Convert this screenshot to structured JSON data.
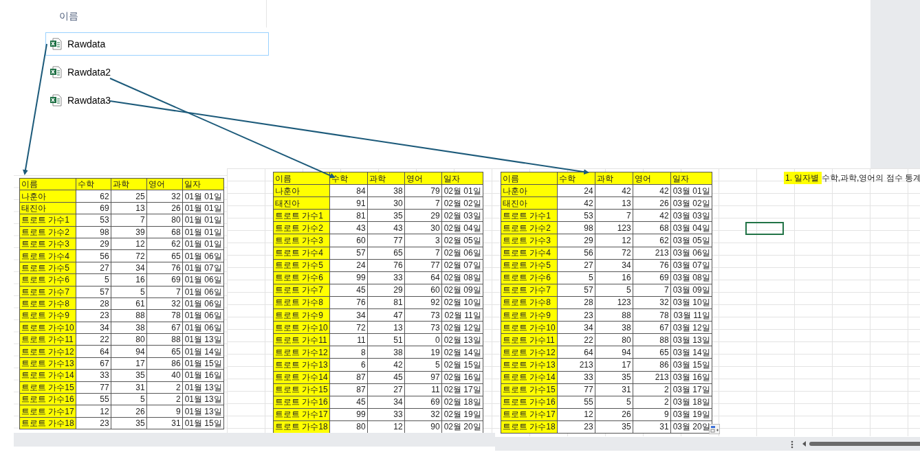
{
  "explorer": {
    "column_header": "이름",
    "files": [
      {
        "name": "Rawdata",
        "selected": true
      },
      {
        "name": "Rawdata2",
        "selected": false
      },
      {
        "name": "Rawdata3",
        "selected": false
      }
    ]
  },
  "tables": [
    {
      "columns": [
        "이름",
        "수학",
        "과학",
        "영어",
        "일자"
      ],
      "rows": [
        [
          "나훈아",
          "62",
          "25",
          "32",
          "01월 01일"
        ],
        [
          "태진아",
          "69",
          "13",
          "26",
          "01월 01일"
        ],
        [
          "트로트 가수1",
          "53",
          "7",
          "80",
          "01월 01일"
        ],
        [
          "트로트 가수2",
          "98",
          "39",
          "68",
          "01월 01일"
        ],
        [
          "트로트 가수3",
          "29",
          "12",
          "62",
          "01월 01일"
        ],
        [
          "트로트 가수4",
          "56",
          "72",
          "65",
          "01월 06일"
        ],
        [
          "트로트 가수5",
          "27",
          "34",
          "76",
          "01월 07일"
        ],
        [
          "트로트 가수6",
          "5",
          "16",
          "69",
          "01월 06일"
        ],
        [
          "트로트 가수7",
          "57",
          "5",
          "7",
          "01월 06일"
        ],
        [
          "트로트 가수8",
          "28",
          "61",
          "32",
          "01월 06일"
        ],
        [
          "트로트 가수9",
          "23",
          "88",
          "78",
          "01월 06일"
        ],
        [
          "트로트 가수10",
          "34",
          "38",
          "67",
          "01월 06일"
        ],
        [
          "트로트 가수11",
          "22",
          "80",
          "88",
          "01월 13일"
        ],
        [
          "트로트 가수12",
          "64",
          "94",
          "65",
          "01월 14일"
        ],
        [
          "트로트 가수13",
          "67",
          "17",
          "86",
          "01월 15일"
        ],
        [
          "트로트 가수14",
          "33",
          "35",
          "40",
          "01월 16일"
        ],
        [
          "트로트 가수15",
          "77",
          "31",
          "2",
          "01월 13일"
        ],
        [
          "트로트 가수16",
          "55",
          "5",
          "2",
          "01월 13일"
        ],
        [
          "트로트 가수17",
          "12",
          "26",
          "9",
          "01월 13일"
        ],
        [
          "트로트 가수18",
          "23",
          "35",
          "31",
          "01월 15일"
        ]
      ]
    },
    {
      "columns": [
        "이름",
        "수학",
        "과학",
        "영어",
        "일자"
      ],
      "rows": [
        [
          "나훈아",
          "84",
          "38",
          "79",
          "02월 01일"
        ],
        [
          "태진아",
          "91",
          "30",
          "7",
          "02월 02일"
        ],
        [
          "트로트 가수1",
          "81",
          "35",
          "29",
          "02월 03일"
        ],
        [
          "트로트 가수2",
          "43",
          "43",
          "30",
          "02월 04일"
        ],
        [
          "트로트 가수3",
          "60",
          "77",
          "3",
          "02월 05일"
        ],
        [
          "트로트 가수4",
          "57",
          "65",
          "7",
          "02월 06일"
        ],
        [
          "트로트 가수5",
          "24",
          "76",
          "77",
          "02월 07일"
        ],
        [
          "트로트 가수6",
          "99",
          "33",
          "64",
          "02월 08일"
        ],
        [
          "트로트 가수7",
          "45",
          "29",
          "60",
          "02월 09일"
        ],
        [
          "트로트 가수8",
          "76",
          "81",
          "92",
          "02월 10일"
        ],
        [
          "트로트 가수9",
          "34",
          "47",
          "73",
          "02월 11일"
        ],
        [
          "트로트 가수10",
          "72",
          "13",
          "73",
          "02월 12일"
        ],
        [
          "트로트 가수11",
          "11",
          "51",
          "0",
          "02월 13일"
        ],
        [
          "트로트 가수12",
          "8",
          "38",
          "19",
          "02월 14일"
        ],
        [
          "트로트 가수13",
          "6",
          "42",
          "5",
          "02월 15일"
        ],
        [
          "트로트 가수14",
          "87",
          "45",
          "97",
          "02월 16일"
        ],
        [
          "트로트 가수15",
          "87",
          "27",
          "11",
          "02월 17일"
        ],
        [
          "트로트 가수16",
          "45",
          "34",
          "69",
          "02월 18일"
        ],
        [
          "트로트 가수17",
          "99",
          "33",
          "32",
          "02월 19일"
        ],
        [
          "트로트 가수18",
          "80",
          "12",
          "90",
          "02월 20일"
        ]
      ]
    },
    {
      "columns": [
        "이름",
        "수학",
        "과학",
        "영어",
        "일자"
      ],
      "rows": [
        [
          "나훈아",
          "24",
          "42",
          "42",
          "03월 01일"
        ],
        [
          "태진아",
          "42",
          "13",
          "26",
          "03월 02일"
        ],
        [
          "트로트 가수1",
          "53",
          "7",
          "42",
          "03월 03일"
        ],
        [
          "트로트 가수2",
          "98",
          "123",
          "68",
          "03월 04일"
        ],
        [
          "트로트 가수3",
          "29",
          "12",
          "62",
          "03월 05일"
        ],
        [
          "트로트 가수4",
          "56",
          "72",
          "213",
          "03월 06일"
        ],
        [
          "트로트 가수5",
          "27",
          "34",
          "76",
          "03월 07일"
        ],
        [
          "트로트 가수6",
          "5",
          "16",
          "69",
          "03월 08일"
        ],
        [
          "트로트 가수7",
          "57",
          "5",
          "7",
          "03월 09일"
        ],
        [
          "트로트 가수8",
          "28",
          "123",
          "32",
          "03월 10일"
        ],
        [
          "트로트 가수9",
          "23",
          "88",
          "78",
          "03월 11일"
        ],
        [
          "트로트 가수10",
          "34",
          "38",
          "67",
          "03월 12일"
        ],
        [
          "트로트 가수11",
          "22",
          "80",
          "88",
          "03월 13일"
        ],
        [
          "트로트 가수12",
          "64",
          "94",
          "65",
          "03월 14일"
        ],
        [
          "트로트 가수13",
          "213",
          "17",
          "86",
          "03월 15일"
        ],
        [
          "트로트 가수14",
          "33",
          "35",
          "213",
          "03월 16일"
        ],
        [
          "트로트 가수15",
          "77",
          "31",
          "2",
          "03월 17일"
        ],
        [
          "트로트 가수16",
          "55",
          "5",
          "2",
          "03월 18일"
        ],
        [
          "트로트 가수17",
          "12",
          "26",
          "9",
          "03월 19일"
        ],
        [
          "트로트 가수18",
          "23",
          "35",
          "31",
          "03월 20일"
        ]
      ]
    }
  ],
  "sheet_title": "1. 일자별 수학,과학,영어의 점수 통계"
}
